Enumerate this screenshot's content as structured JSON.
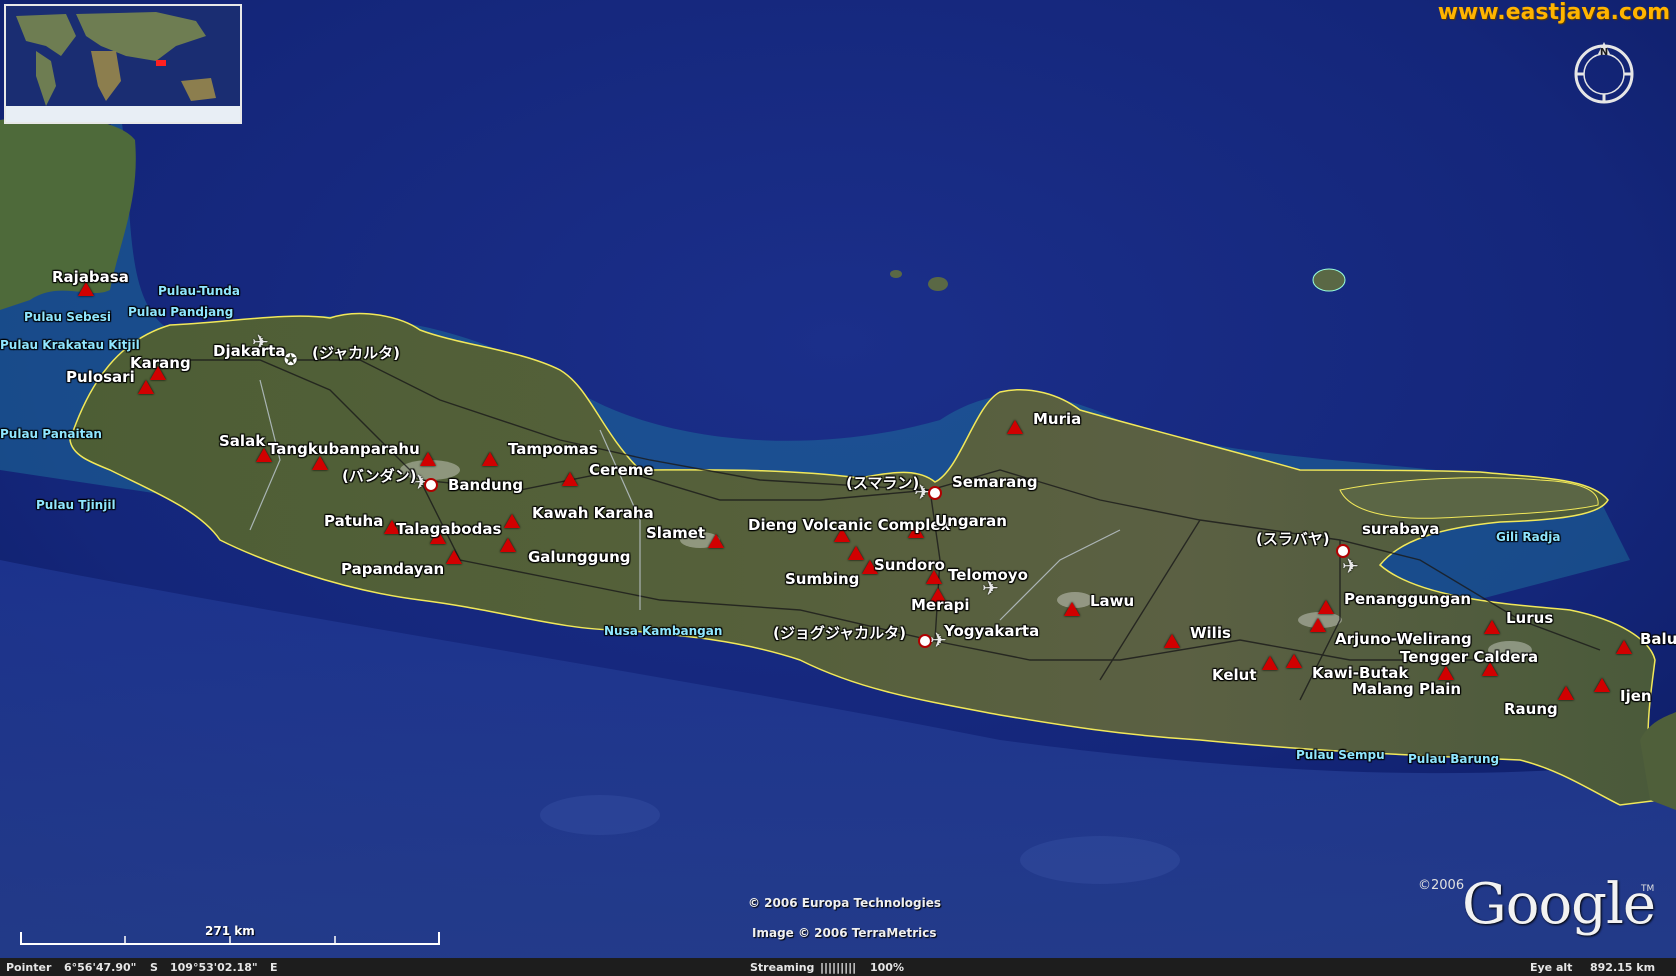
{
  "brand": "www.eastjava.com",
  "compass_letter": "N",
  "copyright": {
    "line1": "© 2006 Europa Technologies",
    "line2": "Image © 2006 TerraMetrics"
  },
  "logo": {
    "text": "Google",
    "year": "©2006",
    "tm": "TM"
  },
  "scale_label": "271 km",
  "status": {
    "pointer_label": "Pointer",
    "lat": "6°56'47.90\"",
    "lat_dir": "S",
    "lon": "109°53'02.18\"",
    "lon_dir": "E",
    "streaming_label": "Streaming",
    "streaming_bar": "|||||||||",
    "streaming_pct": "100%",
    "eye_alt_label": "Eye alt",
    "eye_alt_value": "892.15 km"
  },
  "colors": {
    "volcano": "#d10000",
    "label": "#ffffff",
    "island_label": "#8fe6ff",
    "brand": "#ffb400"
  },
  "volcanoes": [
    "Rajabasa",
    "Karang",
    "Pulosari",
    "Salak",
    "Tangkubanparahu",
    "Tampomas",
    "Cereme",
    "Patuha",
    "Talagabodas",
    "Papandayan",
    "Galunggung",
    "Kawah Karaha",
    "Slamet",
    "Dieng Volcanic Complex",
    "Sundoro",
    "Sumbing",
    "Ungaran",
    "Telomoyo",
    "Merapi",
    "Muria",
    "Lawu",
    "Wilis",
    "Kelut",
    "Kawi-Butak",
    "Arjuno-Welirang",
    "Penanggungan",
    "Tengger Caldera",
    "Lurus",
    "Raung",
    "Ijen",
    "Balur"
  ],
  "cities": {
    "jakarta": "Djakarta",
    "jakarta_jp": "(ジャカルタ)",
    "bandung": "Bandung",
    "bandung_jp": "(バンダン)",
    "semarang": "Semarang",
    "semarang_jp": "(スマラン)",
    "yogyakarta": "Yogyakarta",
    "yogyakarta_jp": "(ジョグジャカルタ)",
    "surabaya": "surabaya",
    "surabaya_jp": "(スラバヤ)",
    "malang": "Malang Plain"
  },
  "islands": [
    "Pulau-Tunda",
    "Pulau Sebesi",
    "Pulau Pandjang",
    "Pulau Krakatau Kitjil",
    "Pulau Panaitan",
    "Pulau Tjinjil",
    "Nusa Kambangan",
    "Gili Radja",
    "Pulau Sempu",
    "Pulau Barung"
  ]
}
